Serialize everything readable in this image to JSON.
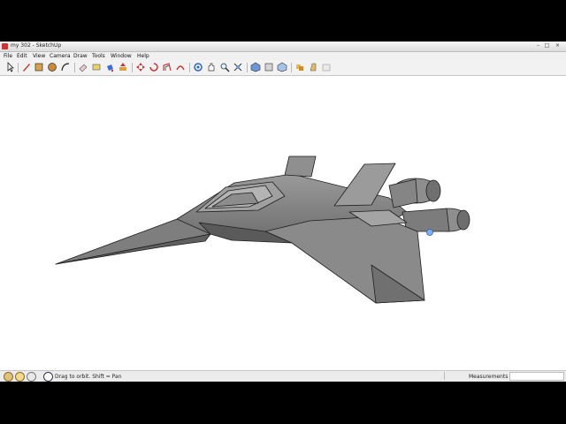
{
  "window": {
    "title": "my 302 - SketchUp",
    "app_icon": "sketchup-logo-icon"
  },
  "menu": [
    "File",
    "Edit",
    "View",
    "Camera",
    "Draw",
    "Tools",
    "Window",
    "Help"
  ],
  "toolbar": {
    "tools": [
      "select-arrow-icon",
      "line-pencil-icon",
      "rectangle-icon",
      "circle-icon",
      "arc-icon",
      "eraser-icon",
      "tape-measure-icon",
      "paint-bucket-icon",
      "push-pull-icon",
      "move-icon",
      "rotate-icon",
      "offset-icon",
      "orbit-icon",
      "pan-icon",
      "zoom-icon",
      "zoom-extents-icon",
      "standard-views-icon",
      "section-icon",
      "materials-icon",
      "components-icon",
      "warehouse-icon",
      "shadows-icon"
    ]
  },
  "status": {
    "hint": "Drag to orbit.  Shift = Pan",
    "measurements_label": "Measurements",
    "measurements_value": ""
  },
  "colors": {
    "window_bg": "#ffffff",
    "model_fill": "#8a8a8a",
    "model_edge": "#1e1e1e"
  }
}
